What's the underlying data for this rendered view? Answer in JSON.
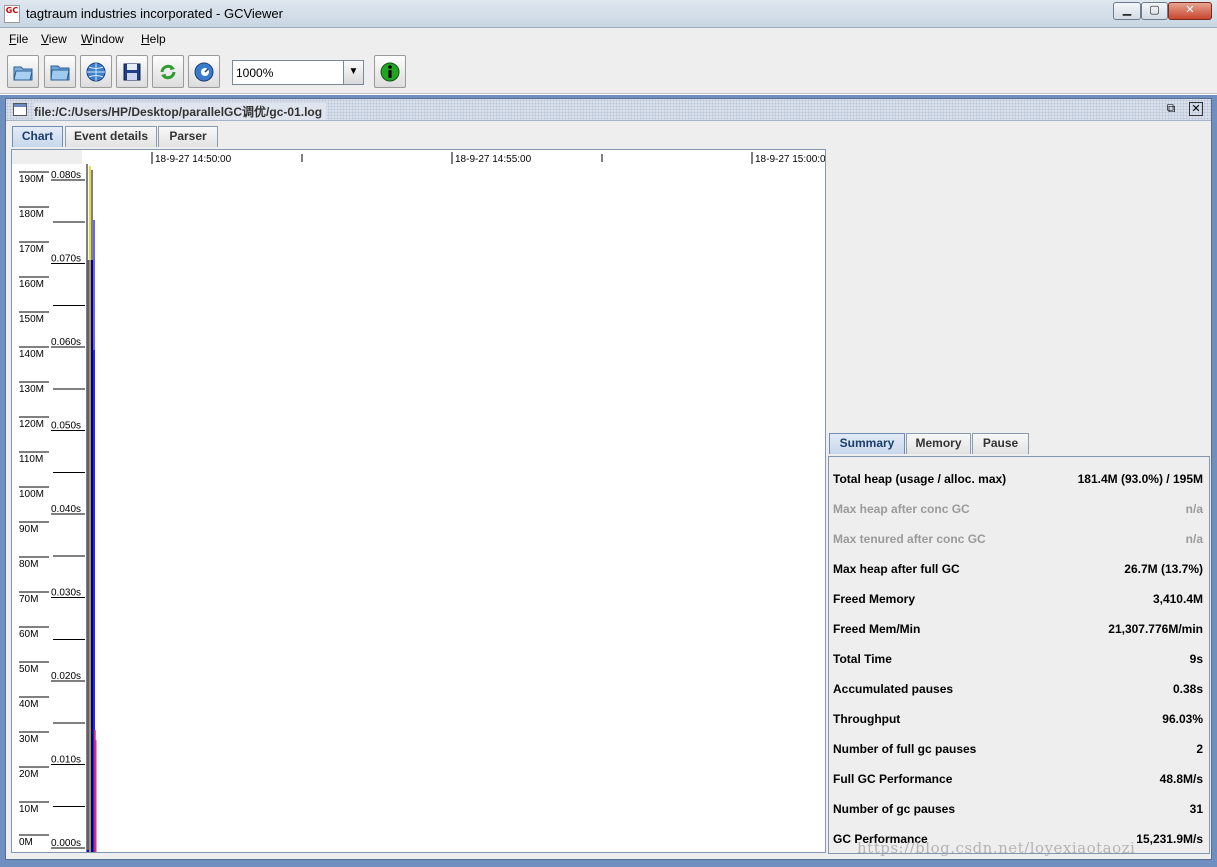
{
  "window": {
    "app_logo": "GC",
    "title": "tagtraum industries incorporated - GCViewer",
    "min_label": "▁",
    "max_label": "▢",
    "close_label": "✕"
  },
  "menubar": {
    "items": [
      {
        "label": "File",
        "mnemonic": "F",
        "rest": "ile"
      },
      {
        "label": "View",
        "mnemonic": "V",
        "rest": "iew"
      },
      {
        "label": "Window",
        "mnemonic": "W",
        "rest": "indow"
      },
      {
        "label": "Help",
        "mnemonic": "H",
        "rest": "elp"
      }
    ]
  },
  "toolbar": {
    "buttons": [
      {
        "icon": "open-file-icon"
      },
      {
        "icon": "open-folder-icon"
      },
      {
        "icon": "open-url-icon"
      },
      {
        "icon": "export-icon"
      },
      {
        "icon": "refresh-icon"
      },
      {
        "icon": "watch-icon"
      }
    ],
    "zoom": {
      "value": "1000%"
    },
    "info_icon": "info-icon"
  },
  "document": {
    "path": "file:/C:/Users/HP/Desktop/parallelGC调优/gc-01.log",
    "restore_label": "⧉",
    "close_label": "✕"
  },
  "main_tabs": [
    {
      "label": "Chart",
      "active": true
    },
    {
      "label": "Event details",
      "active": false
    },
    {
      "label": "Parser",
      "active": false
    }
  ],
  "chart": {
    "timeline_labels": [
      "18-9-27 14:50:00",
      "18-9-27 14:55:00",
      "18-9-27 15:00:0"
    ],
    "memory_axis": [
      "190M",
      "180M",
      "170M",
      "160M",
      "150M",
      "140M",
      "130M",
      "120M",
      "110M",
      "100M",
      "90M",
      "80M",
      "70M",
      "60M",
      "50M",
      "40M",
      "30M",
      "20M",
      "10M",
      "0M"
    ],
    "pause_axis": [
      "0.080s",
      "0.070s",
      "0.060s",
      "0.050s",
      "0.040s",
      "0.030s",
      "0.020s",
      "0.010s",
      "0.000s"
    ],
    "colors": {
      "heap": "#0000ff",
      "full_gc": "#000000",
      "gc": "#e0d000",
      "young": "#ff3030",
      "pause": "#c030c0"
    }
  },
  "summary_tabs": [
    {
      "label": "Summary",
      "active": true
    },
    {
      "label": "Memory",
      "active": false
    },
    {
      "label": "Pause",
      "active": false
    }
  ],
  "summary": [
    {
      "label": "Total heap (usage / alloc. max)",
      "value": "181.4M (93.0%) / 195M",
      "enabled": true
    },
    {
      "label": "Max heap after conc GC",
      "value": "n/a",
      "enabled": false
    },
    {
      "label": "Max tenured after conc GC",
      "value": "n/a",
      "enabled": false
    },
    {
      "label": "Max heap after full GC",
      "value": "26.7M (13.7%)",
      "enabled": true
    },
    {
      "label": "Freed Memory",
      "value": "3,410.4M",
      "enabled": true
    },
    {
      "label": "Freed Mem/Min",
      "value": "21,307.776M/min",
      "enabled": true
    },
    {
      "label": "Total Time",
      "value": "9s",
      "enabled": true
    },
    {
      "label": "Accumulated pauses",
      "value": "0.38s",
      "enabled": true
    },
    {
      "label": "Throughput",
      "value": "96.03%",
      "enabled": true
    },
    {
      "label": "Number of full gc pauses",
      "value": "2",
      "enabled": true
    },
    {
      "label": "Full GC Performance",
      "value": "48.8M/s",
      "enabled": true
    },
    {
      "label": "Number of gc pauses",
      "value": "31",
      "enabled": true
    },
    {
      "label": "GC Performance",
      "value": "15,231.9M/s",
      "enabled": true
    }
  ],
  "watermark": "https://blog.csdn.net/loyexiaotaozi"
}
